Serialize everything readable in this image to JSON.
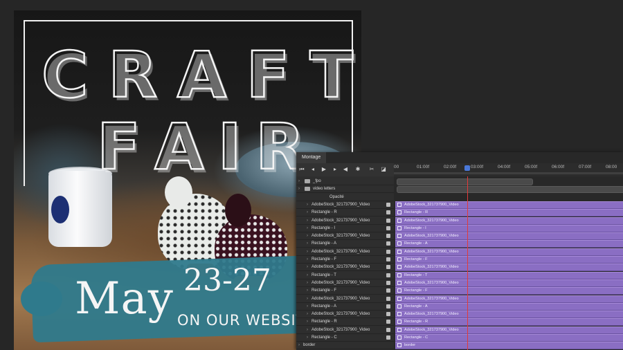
{
  "poster": {
    "title_row1": [
      "C",
      "R",
      "A",
      "F",
      "T"
    ],
    "title_row2": [
      "F",
      "A",
      "I",
      "R"
    ],
    "date_month": "May",
    "date_range": "23-27",
    "date_sub": "ON OUR WEBSITE"
  },
  "timeline": {
    "tab_label": "Montage",
    "ruler_ticks": [
      "00",
      "01:00f",
      "02:00f",
      "03:00f",
      "04:00f",
      "05:00f",
      "06:00f",
      "07:00f",
      "08:00"
    ],
    "layers": [
      {
        "label": "_fpo",
        "type": "folder",
        "indent": 0
      },
      {
        "label": "video letters",
        "type": "folder",
        "indent": 0
      },
      {
        "label": "Opacité",
        "type": "property",
        "indent": 1
      },
      {
        "label": "AdobeStock_321737900_Video",
        "type": "video",
        "indent": 1
      },
      {
        "label": "Rectangle - R",
        "type": "shape",
        "indent": 1
      },
      {
        "label": "AdobeStock_321737900_Video",
        "type": "video",
        "indent": 1
      },
      {
        "label": "Rectangle - I",
        "type": "shape",
        "indent": 1
      },
      {
        "label": "AdobeStock_321737900_Video",
        "type": "video",
        "indent": 1
      },
      {
        "label": "Rectangle - A",
        "type": "shape",
        "indent": 1
      },
      {
        "label": "AdobeStock_321737900_Video",
        "type": "video",
        "indent": 1
      },
      {
        "label": "Rectangle - F",
        "type": "shape",
        "indent": 1
      },
      {
        "label": "AdobeStock_321737900_Video",
        "type": "video",
        "indent": 1
      },
      {
        "label": "Rectangle - T",
        "type": "shape",
        "indent": 1
      },
      {
        "label": "AdobeStock_321737900_Video",
        "type": "video",
        "indent": 1
      },
      {
        "label": "Rectangle - F",
        "type": "shape",
        "indent": 1
      },
      {
        "label": "AdobeStock_321737900_Video",
        "type": "video",
        "indent": 1
      },
      {
        "label": "Rectangle - A",
        "type": "shape",
        "indent": 1
      },
      {
        "label": "AdobeStock_321737900_Video",
        "type": "video",
        "indent": 1
      },
      {
        "label": "Rectangle - R",
        "type": "shape",
        "indent": 1
      },
      {
        "label": "AdobeStock_321737900_Video",
        "type": "video",
        "indent": 1
      },
      {
        "label": "Rectangle - C",
        "type": "shape",
        "indent": 1
      },
      {
        "label": "border",
        "type": "folder",
        "indent": 0
      }
    ],
    "clips": [
      "AdobeStock_321737900_Video",
      "Rectangle - R",
      "AdobeStock_321737900_Video",
      "Rectangle - I",
      "AdobeStock_321737900_Video",
      "Rectangle - A",
      "AdobeStock_321737900_Video",
      "Rectangle - F",
      "AdobeStock_321737900_Video",
      "Rectangle - T",
      "AdobeStock_321737900_Video",
      "Rectangle - F",
      "AdobeStock_321737900_Video",
      "Rectangle - A",
      "AdobeStock_321737900_Video",
      "Rectangle - R",
      "AdobeStock_321737900_Video",
      "Rectangle - C",
      "border"
    ],
    "toolbar_icons": [
      "go-to-start-icon",
      "step-back-icon",
      "play-icon",
      "step-forward-icon",
      "audio-icon",
      "settings-icon",
      "split-icon",
      "transition-icon"
    ],
    "colors": {
      "clip": "#8a6ec3",
      "playhead": "#e23a3a",
      "panel": "#323232"
    }
  }
}
